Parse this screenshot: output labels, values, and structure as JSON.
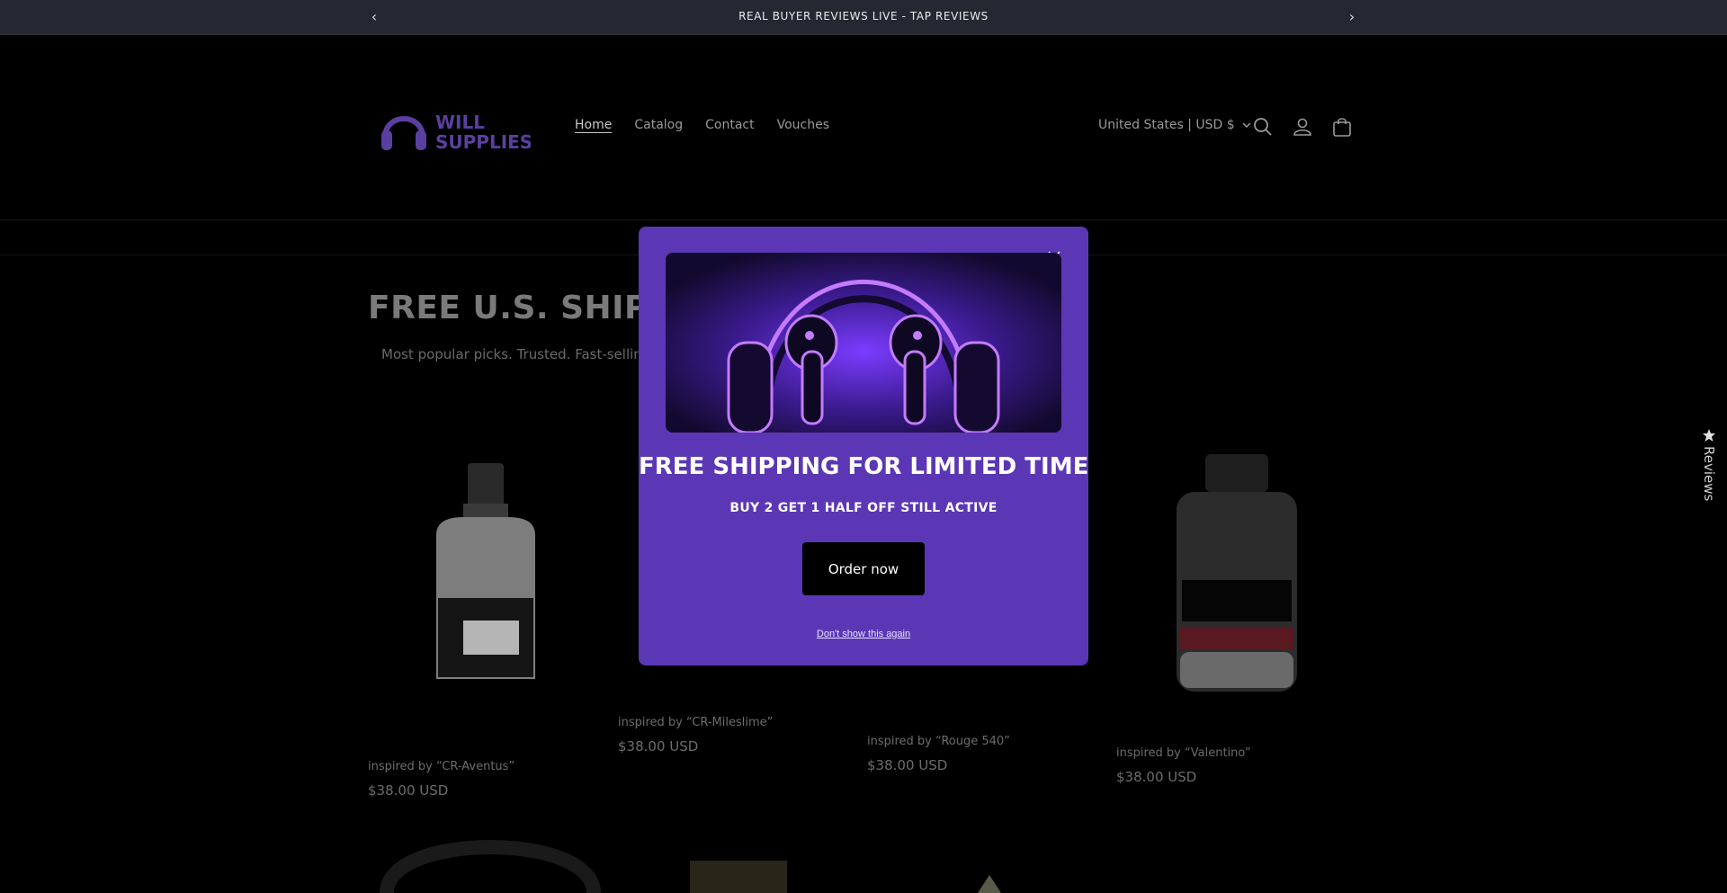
{
  "announcement": {
    "text": "REAL BUYER REVIEWS LIVE - TAP REVIEWS",
    "prev_icon": "chevron-left-icon",
    "next_icon": "chevron-right-icon"
  },
  "header": {
    "logo_text_line1": "WILL",
    "logo_text_line2": "SUPPLIES",
    "nav": [
      {
        "label": "Home",
        "active": true
      },
      {
        "label": "Catalog",
        "active": false
      },
      {
        "label": "Contact",
        "active": false
      },
      {
        "label": "Vouches",
        "active": false
      }
    ],
    "locale": "United States | USD $",
    "icons": [
      "search-icon",
      "account-icon",
      "cart-icon"
    ]
  },
  "collection": {
    "title": "FREE U.S. SHIPPI",
    "subtitle": "Most popular picks. Trusted. Fast-selling"
  },
  "products": [
    {
      "title": "inspired by “CR-Aventus”",
      "price": "$38.00 USD"
    },
    {
      "title": "inspired by “CR-Mileslime”",
      "price": "$38.00 USD"
    },
    {
      "title": "inspired by “Rouge 540”",
      "price": "$38.00 USD"
    },
    {
      "title": "inspired by “Valentino”",
      "price": "$38.00 USD"
    }
  ],
  "reviews_tab": {
    "label": "Reviews",
    "icon": "star-icon"
  },
  "popup": {
    "title": "FREE SHIPPING FOR LIMITED TIME",
    "subtitle": "BUY 2 GET 1 HALF OFF STILL ACTIVE",
    "cta": "Order now",
    "dismiss": "Don't show this again",
    "background": "#5b37b5"
  },
  "colors": {
    "announcement_bg": "#242833",
    "page_bg": "#000000",
    "brand_purple": "#5b37b5"
  }
}
